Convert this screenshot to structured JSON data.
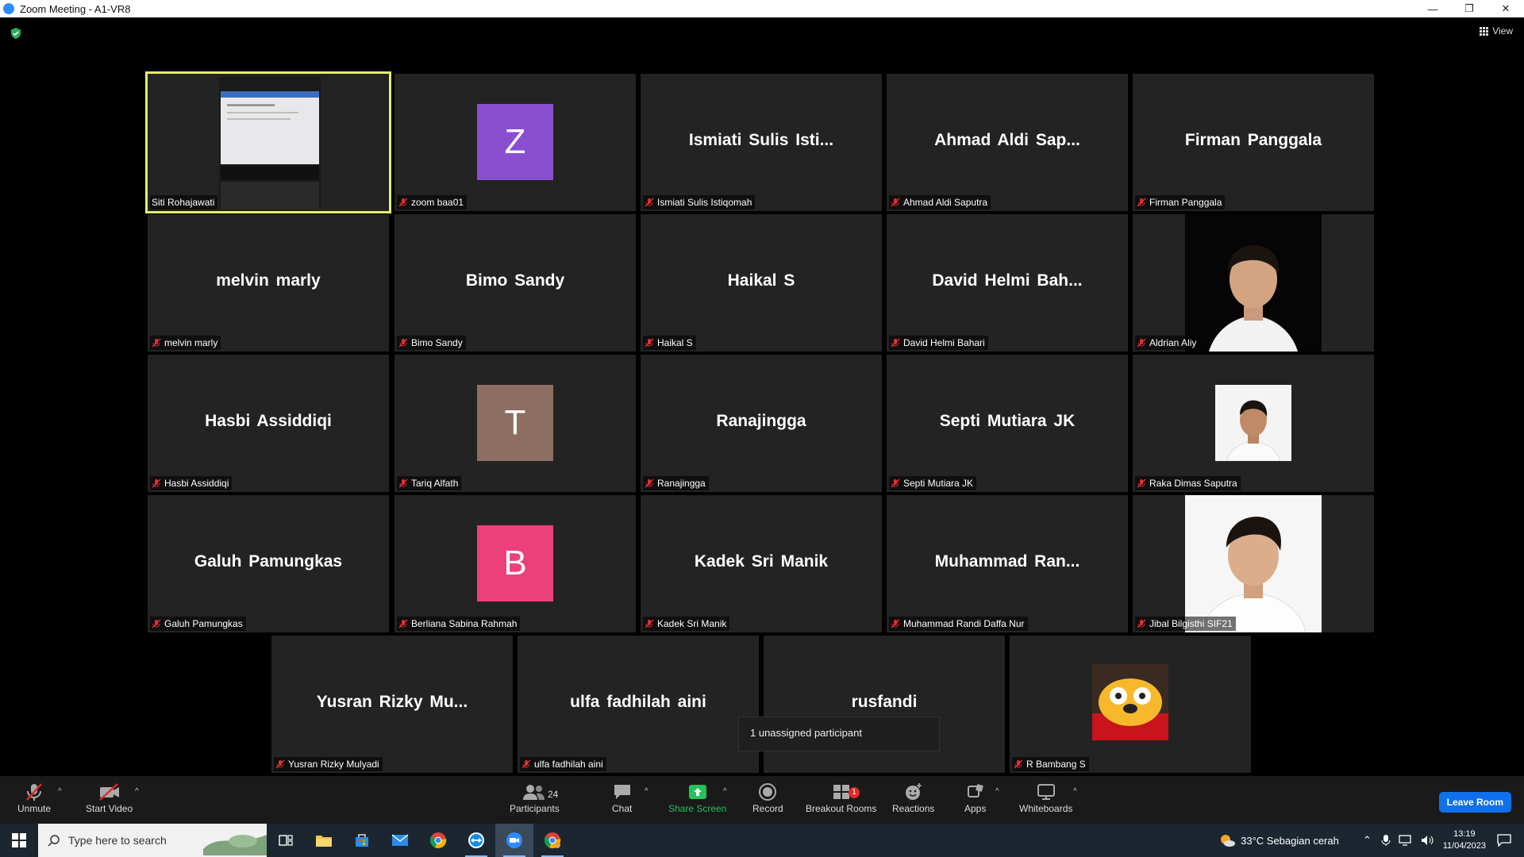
{
  "window": {
    "title": "Zoom Meeting - A1-VR8",
    "minimize": "—",
    "restore": "❐",
    "close": "✕"
  },
  "view_label": "View",
  "tiles_row1": [
    {
      "label": "Siti Rohajawati",
      "type": "screen",
      "muted": false,
      "active": true
    },
    {
      "label": "zoom baa01",
      "type": "avatar",
      "letter": "Z",
      "color": "#8a4fd0",
      "muted": true
    },
    {
      "label": "Ismiati Sulis Istiqomah",
      "big": "Ismiati  Sulis  Isti...",
      "type": "name",
      "muted": true
    },
    {
      "label": "Ahmad Aldi Saputra",
      "big": "Ahmad  Aldi  Sap...",
      "type": "name",
      "muted": true
    },
    {
      "label": "Firman Panggala",
      "big": "Firman Panggala",
      "type": "name",
      "muted": true
    }
  ],
  "tiles_row2": [
    {
      "label": "melvin marly",
      "big": "melvin marly",
      "type": "name",
      "muted": true
    },
    {
      "label": "Bimo Sandy",
      "big": "Bimo Sandy",
      "type": "name",
      "muted": true
    },
    {
      "label": "Haikal S",
      "big": "Haikal S",
      "type": "name",
      "muted": true
    },
    {
      "label": "David Helmi Bahari",
      "big": "David  Helmi  Bah...",
      "type": "name",
      "muted": true
    },
    {
      "label": "Aldrian Aliy",
      "type": "photo",
      "muted": true
    }
  ],
  "tiles_row3": [
    {
      "label": "Hasbi Assiddiqi",
      "big": "Hasbi Assiddiqi",
      "type": "name",
      "muted": true
    },
    {
      "label": "Tariq Alfath",
      "type": "avatar",
      "letter": "T",
      "color": "#8d6e63",
      "muted": true
    },
    {
      "label": "Ranajingga",
      "big": "Ranajingga",
      "type": "name",
      "muted": true
    },
    {
      "label": "Septi Mutiara JK",
      "big": "Septi Mutiara JK",
      "type": "name",
      "muted": true
    },
    {
      "label": "Raka Dimas Saputra",
      "type": "photo",
      "muted": true
    }
  ],
  "tiles_row4": [
    {
      "label": "Galuh Pamungkas",
      "big": "Galuh Pamungkas",
      "type": "name",
      "muted": true
    },
    {
      "label": "Berliana Sabina Rahmah",
      "type": "avatar",
      "letter": "B",
      "color": "#ec407a",
      "muted": true
    },
    {
      "label": "Kadek Sri Manik",
      "big": "Kadek Sri Manik",
      "type": "name",
      "muted": true
    },
    {
      "label": "Muhammad Randi Daffa Nur",
      "big": "Muhammad  Ran...",
      "type": "name",
      "muted": true
    },
    {
      "label": "Jibal Bilgisthi SIF21",
      "type": "photo",
      "muted": true
    }
  ],
  "tiles_row5": [
    {
      "label": "Yusran Rizky Mulyadi",
      "big": "Yusran  Rizky  Mu...",
      "type": "name",
      "muted": true
    },
    {
      "label": "ulfa fadhilah aini",
      "big": "ulfa fadhilah aini",
      "type": "name",
      "muted": true
    },
    {
      "label": "",
      "big": "rusfandi",
      "type": "name",
      "muted": false
    },
    {
      "label": "R Bambang S",
      "type": "cartoon",
      "muted": true
    }
  ],
  "tooltip": "1 unassigned participant",
  "toolbar": {
    "unmute": "Unmute",
    "start_video": "Start Video",
    "participants": "Participants",
    "participants_count": "24",
    "chat": "Chat",
    "share_screen": "Share Screen",
    "record": "Record",
    "breakout_rooms": "Breakout Rooms",
    "breakout_badge": "1",
    "reactions": "Reactions",
    "apps": "Apps",
    "whiteboards": "Whiteboards",
    "leave": "Leave Room"
  },
  "taskbar": {
    "search_placeholder": "Type here to search",
    "weather": "33°C  Sebagian cerah",
    "time": "13:19",
    "date": "11/04/2023"
  }
}
